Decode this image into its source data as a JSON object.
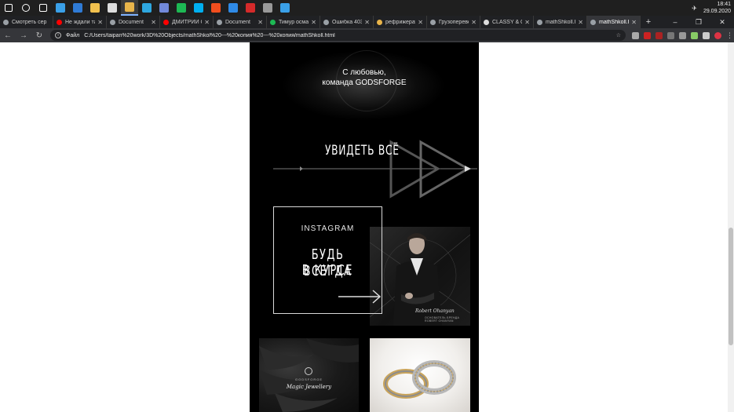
{
  "taskbar": {
    "apps": [
      {
        "name": "windows-start-icon",
        "color": "#ffffff"
      },
      {
        "name": "search-icon",
        "color": "#ffffff"
      },
      {
        "name": "task-view-icon",
        "color": "#ffffff"
      },
      {
        "name": "edge-icon",
        "color": "#3aa0e8"
      },
      {
        "name": "mail-icon",
        "color": "#2f7bd6"
      },
      {
        "name": "explorer-icon",
        "color": "#f2c14e"
      },
      {
        "name": "store-icon",
        "color": "#dddddd"
      },
      {
        "name": "chrome-icon",
        "color": "#e8b44a"
      },
      {
        "name": "telegram-icon",
        "color": "#2ea7e0"
      },
      {
        "name": "discord-icon",
        "color": "#7289da"
      },
      {
        "name": "spotify-icon",
        "color": "#1db954"
      },
      {
        "name": "skype-icon",
        "color": "#00aff0"
      },
      {
        "name": "figma-icon",
        "color": "#f24e1e"
      },
      {
        "name": "vscode-icon",
        "color": "#2f8ae6"
      },
      {
        "name": "filezilla-icon",
        "color": "#d52a2a"
      },
      {
        "name": "calculator-icon",
        "color": "#999999"
      },
      {
        "name": "app-icon",
        "color": "#3aa0e8"
      }
    ],
    "time": "18:41",
    "date": "29.09.2020"
  },
  "tabs": [
    {
      "label": "Смотреть сер",
      "fav": "#9aa0a6",
      "closable": false
    },
    {
      "label": "Не ждали так",
      "fav": "#ff0000",
      "closable": true
    },
    {
      "label": "Document",
      "fav": "#9aa0a6",
      "closable": true
    },
    {
      "label": "ДМИТРИЙ СЕ",
      "fav": "#ff0000",
      "closable": true
    },
    {
      "label": "Document",
      "fav": "#9aa0a6",
      "closable": true
    },
    {
      "label": "Тимур осман",
      "fav": "#1db954",
      "closable": true
    },
    {
      "label": "Ошибка 403",
      "fav": "#9aa0a6",
      "closable": true
    },
    {
      "label": "рефрижерат",
      "fav": "#e8b44a",
      "closable": true
    },
    {
      "label": "Грузоперевоз",
      "fav": "#9aa0a6",
      "closable": true
    },
    {
      "label": "CLASSY & CH",
      "fav": "#dddddd",
      "closable": true
    },
    {
      "label": "mathShkoll.h",
      "fav": "#9aa0a6",
      "closable": true
    },
    {
      "label": "mathShkoll.h",
      "fav": "#9aa0a6",
      "closable": true,
      "active": true
    }
  ],
  "address": {
    "scheme_label": "Файл",
    "url": "C:/Users/taipan%20work/3D%20Objects/mathShkol%20---%20копия%20---%20копия/mathShkoll.html"
  },
  "site": {
    "love_line1": "С любовью,",
    "love_line2": "команда GODSFORGE",
    "see_all": "УВИДЕТЬ ВСЁ",
    "instagram_label": "INSTAGRAM",
    "stay_line1": "БУДЬ ВСЕГДА",
    "stay_line2": "В КУРСЕ",
    "signature": "Robert Ohanyan",
    "signature_sub": "ОСНОВАТЕЛЬ БРЕНДА ROBERT OHANYAN",
    "brand_top": "GODSFORGE",
    "brand_name": "Magic Jewellery"
  }
}
